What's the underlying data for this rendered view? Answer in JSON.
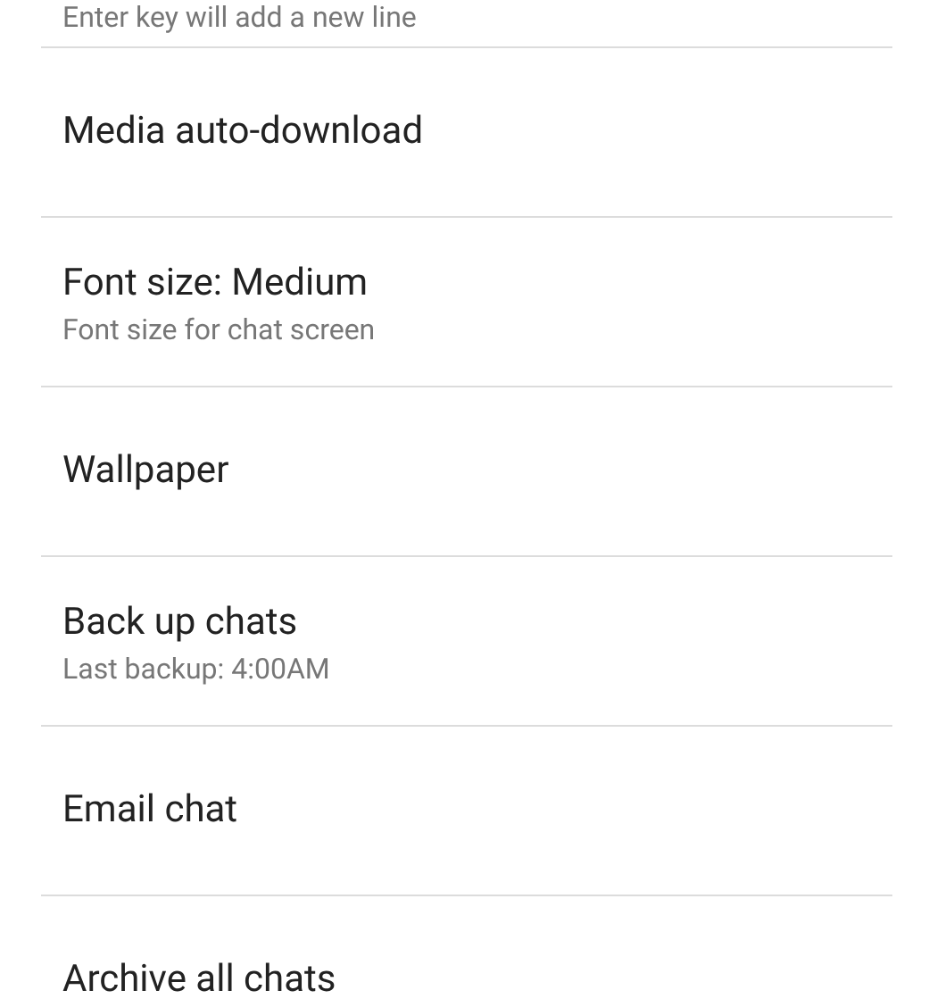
{
  "settings": [
    {
      "subtitle": "Enter key will add a new line"
    },
    {
      "title": "Media auto-download"
    },
    {
      "title": "Font size: Medium",
      "subtitle": "Font size for chat screen"
    },
    {
      "title": "Wallpaper"
    },
    {
      "title": "Back up chats",
      "subtitle": "Last backup: 4:00AM"
    },
    {
      "title": "Email chat"
    },
    {
      "title": "Archive all chats"
    }
  ]
}
